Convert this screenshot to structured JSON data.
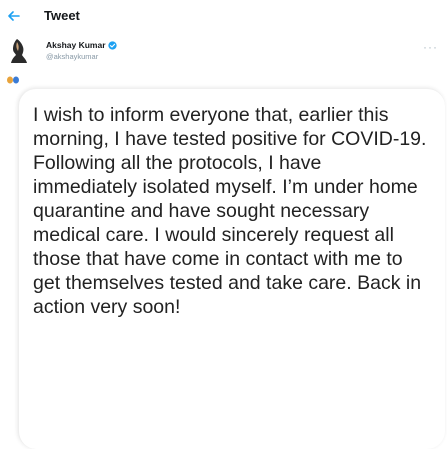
{
  "header": {
    "back_icon": "arrow-left-icon",
    "title": "Tweet"
  },
  "author": {
    "name": "Akshay Kumar",
    "verified_icon": "verified-badge-icon",
    "handle": "@akshaykumar",
    "more_icon": "more-horizontal-icon",
    "more_label": "···"
  },
  "colors": {
    "accent": "#1da1f2",
    "muted": "#8899a6"
  },
  "tweet": {
    "text": "I wish to inform everyone that, earlier this morning, I have tested positive for COVID-19. Following all the protocols, I have immediately isolated myself. I’m under home quarantine and have sought necessary medical care. I would sincerely request all those that have come in contact with me to get themselves tested and take care. Back in action very soon!"
  }
}
